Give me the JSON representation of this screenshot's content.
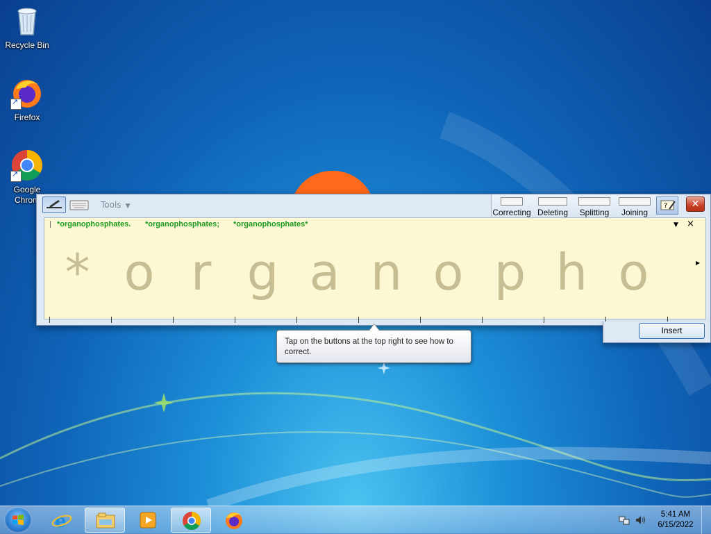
{
  "desktop": {
    "icons": [
      {
        "label": "Recycle Bin",
        "icon": "recycle-bin-icon"
      },
      {
        "label": "Firefox",
        "icon": "firefox-icon"
      },
      {
        "label": "Google Chrom",
        "icon": "chrome-icon"
      }
    ]
  },
  "input_panel": {
    "toolbar": {
      "tools_label": "Tools",
      "help": [
        {
          "label": "Correcting"
        },
        {
          "label": "Deleting"
        },
        {
          "label": "Splitting"
        },
        {
          "label": "Joining"
        }
      ]
    },
    "alternates": [
      "*organophosphates.",
      "*organophosphates;",
      "*organophosphates*"
    ],
    "alternates_dropdown": "▼",
    "alternates_close": "×",
    "recognized_letters": [
      "*",
      "o",
      "r",
      "g",
      "a",
      "n",
      "o",
      "p",
      "h",
      "o"
    ],
    "insert_label": "Insert"
  },
  "tooltip": {
    "text": "Tap on the buttons at the top right to see how to correct."
  },
  "taskbar": {
    "clock_time": "5:41 AM",
    "clock_date": "6/15/2022",
    "items": [
      "internet-explorer-icon",
      "file-explorer-icon",
      "media-player-icon",
      "chrome-icon",
      "firefox-icon"
    ]
  },
  "colors": {
    "alternate_text": "#1f9a1f",
    "writing_background": "#fdf8d4",
    "ink_letters": "#c7bd92",
    "close_button": "#c9422a"
  }
}
